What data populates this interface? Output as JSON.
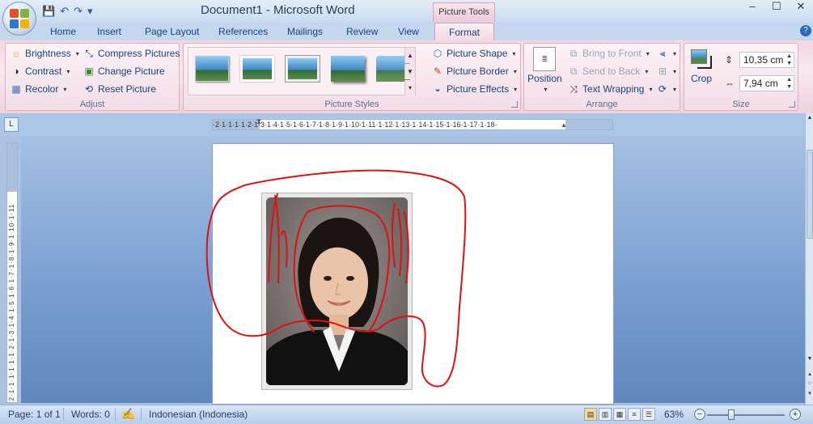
{
  "window": {
    "title": "Document1 - Microsoft Word",
    "context_tab": "Picture Tools"
  },
  "qat": {
    "save_icon": "save-icon",
    "undo_icon": "undo-icon",
    "redo_icon": "redo-icon",
    "customize": "▾"
  },
  "window_controls": {
    "minimize": "–",
    "maximize": "☐",
    "close": "✕"
  },
  "tabs": [
    "Home",
    "Insert",
    "Page Layout",
    "References",
    "Mailings",
    "Review",
    "View"
  ],
  "active_tab": "Format",
  "help": "?",
  "ribbon": {
    "adjust": {
      "label": "Adjust",
      "brightness": "Brightness",
      "contrast": "Contrast",
      "recolor": "Recolor",
      "compress": "Compress Pictures",
      "change": "Change Picture",
      "reset": "Reset Picture"
    },
    "styles": {
      "label": "Picture Styles",
      "shape": "Picture Shape",
      "border": "Picture Border",
      "effects": "Picture Effects"
    },
    "arrange": {
      "label": "Arrange",
      "position": "Position",
      "bring_front": "Bring to Front",
      "send_back": "Send to Back",
      "text_wrapping": "Text Wrapping"
    },
    "size": {
      "label": "Size",
      "crop": "Crop",
      "height": "10,35 cm",
      "width": "7,94 cm"
    }
  },
  "ruler": {
    "horizontal": "·2·1·1·1·1·2·1·3·1·4·1·5·1·6·1·7·1·8·1·9·1·10·1·11·1·12·1·13·1·14·1·15·1·16·1·17·1·18·",
    "vertical": "·2·1·1·1·1·1·1·2·1·3·1·4·1·5·1·6·1·7·1·8·1·9·1·10·1·11"
  },
  "status": {
    "page": "Page: 1 of 1",
    "words": "Words: 0",
    "language": "Indonesian (Indonesia)",
    "zoom": "63%",
    "zoom_level": 0.63
  },
  "colors": {
    "annotation": "#e01010",
    "ribbon_pink": "#f3d6e2",
    "accent": "#15428b"
  }
}
